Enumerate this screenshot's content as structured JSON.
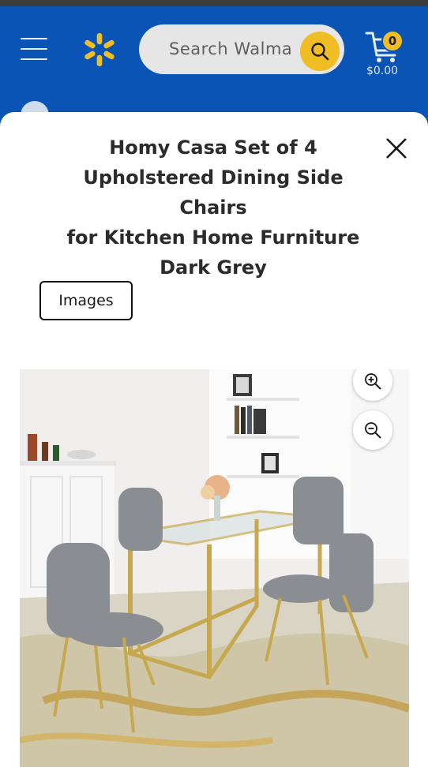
{
  "header": {
    "search_placeholder": "Search Walma",
    "cart_count": "0",
    "cart_total": "$0.00",
    "brand_color": "#0a54b5",
    "accent_color": "#f1bd24"
  },
  "product": {
    "title_lines": [
      "Homy Casa Set of 4",
      "Upholstered Dining Side Chairs",
      "for Kitchen Home Furniture",
      "Dark Grey"
    ]
  },
  "gallery": {
    "images_button_label": "Images",
    "zoom_in_icon": "zoom-in-icon",
    "zoom_out_icon": "zoom-out-icon"
  }
}
